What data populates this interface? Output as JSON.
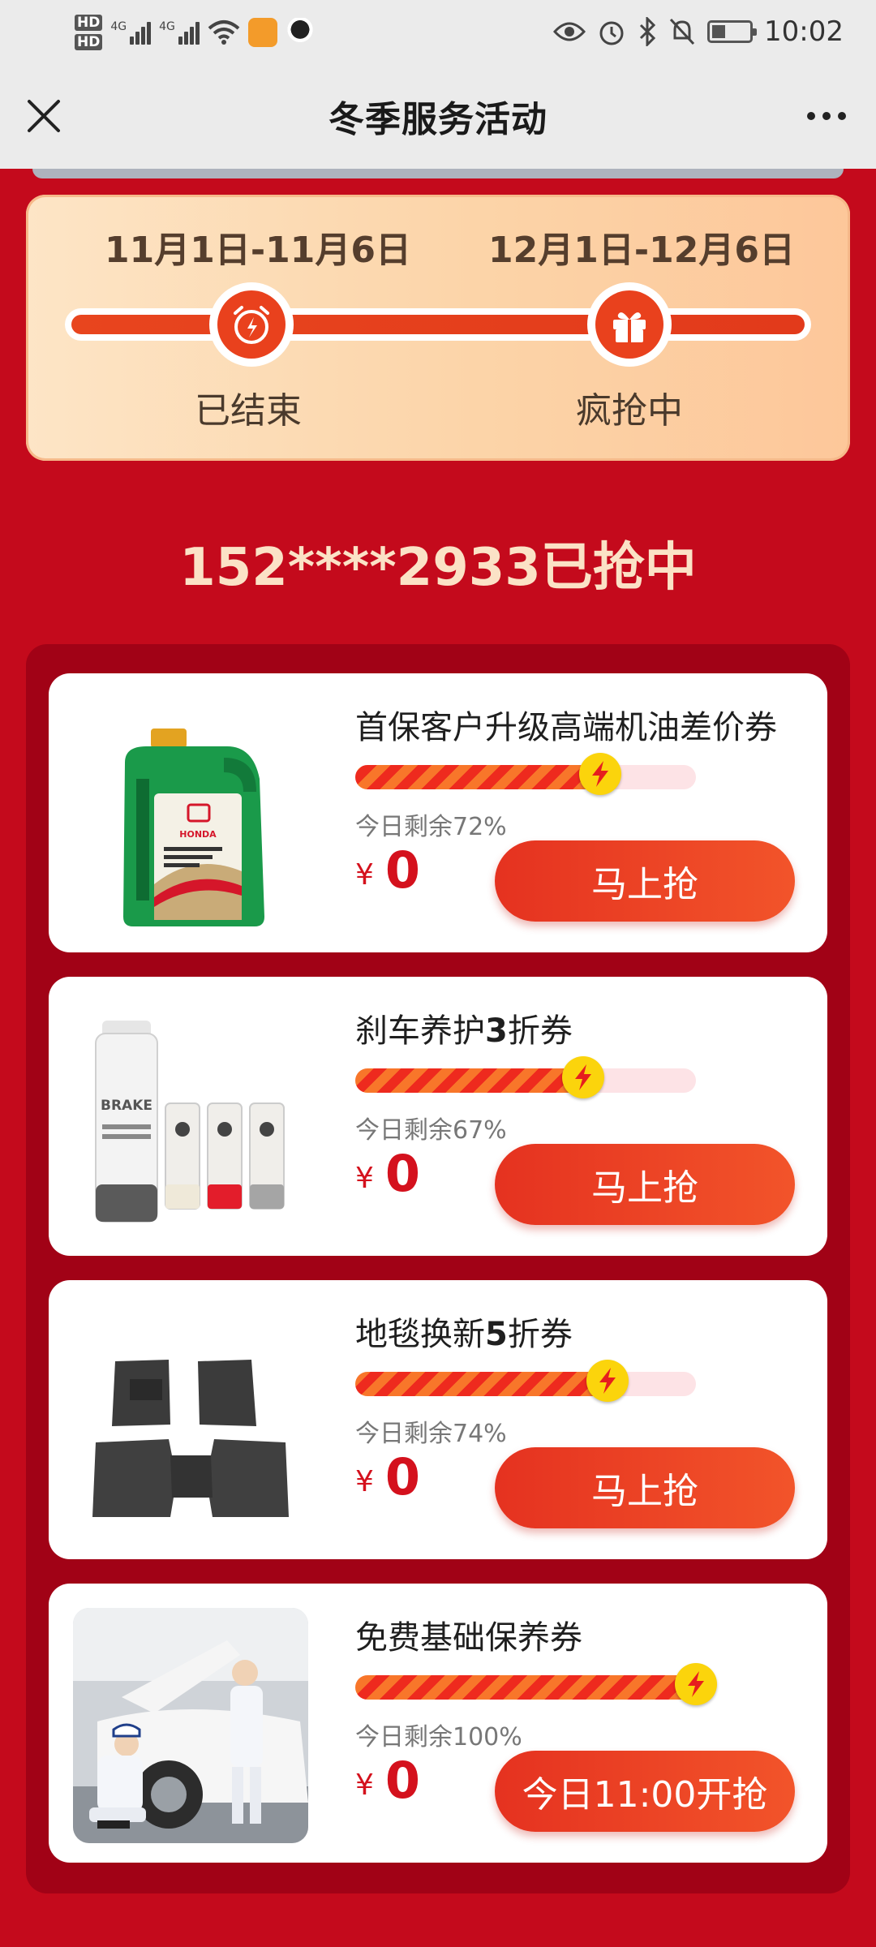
{
  "status_bar": {
    "hd1": "HD",
    "hd2": "HD",
    "net1": "4G",
    "net2": "4G",
    "time": "10:02",
    "icons": [
      "wifi-icon",
      "orange-app-icon",
      "qq-icon",
      "eye-icon",
      "alarm-icon",
      "bluetooth-icon",
      "mute-icon",
      "battery-icon"
    ]
  },
  "nav": {
    "title": "冬季服务活动",
    "close_icon": "close-icon",
    "more_icon": "more-icon"
  },
  "timeline": {
    "periods": [
      {
        "date": "11月1日-11月6日",
        "status": "已结束",
        "icon": "alarm-clock-icon"
      },
      {
        "date": "12月1日-12月6日",
        "status": "疯抢中",
        "icon": "gift-icon"
      }
    ]
  },
  "winner": {
    "text": "152****2933已抢中"
  },
  "coupons": [
    {
      "title": "首保客户升级高端机油差价券",
      "remaining_text": "今日剩余72%",
      "remaining_pct": 72,
      "currency": "¥",
      "price": "0",
      "button_label": "马上抢",
      "image": "engine-oil-image"
    },
    {
      "title_main": "刹车养护",
      "title_bold": "3",
      "title_tail": "折券",
      "remaining_text": "今日剩余67%",
      "remaining_pct": 67,
      "currency": "¥",
      "price": "0",
      "button_label": "马上抢",
      "image": "brake-cleaner-image"
    },
    {
      "title_main": "地毯换新",
      "title_bold": "5",
      "title_tail": "折券",
      "remaining_text": "今日剩余74%",
      "remaining_pct": 74,
      "currency": "¥",
      "price": "0",
      "button_label": "马上抢",
      "image": "floor-mat-image"
    },
    {
      "title": "免费基础保养券",
      "remaining_text": "今日剩余100%",
      "remaining_pct": 100,
      "currency": "¥",
      "price": "0",
      "button_label": "今日11:00开抢",
      "image": "mechanic-service-image"
    }
  ],
  "colors": {
    "page_bg": "#c40a1c",
    "panel_bg": "#a10216",
    "accent": "#e53220",
    "price": "#d4111d",
    "bolt": "#fbd40c"
  }
}
